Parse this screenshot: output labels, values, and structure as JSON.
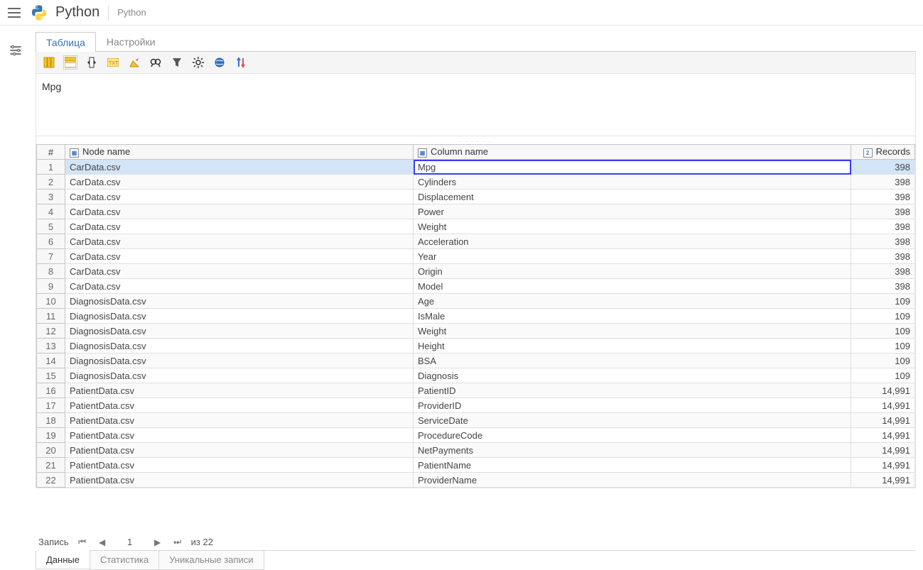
{
  "header": {
    "app_title": "Python",
    "breadcrumb": "Python"
  },
  "tabs": {
    "table": "Таблица",
    "settings": "Настройки"
  },
  "preview_value": "Mpg",
  "columns": {
    "index": "#",
    "node_name": "Node name",
    "column_name": "Column name",
    "records": "Records",
    "records_icon": "2"
  },
  "rows": [
    {
      "idx": 1,
      "node": "CarData.csv",
      "col": "Mpg",
      "rec": "398"
    },
    {
      "idx": 2,
      "node": "CarData.csv",
      "col": "Cylinders",
      "rec": "398"
    },
    {
      "idx": 3,
      "node": "CarData.csv",
      "col": "Displacement",
      "rec": "398"
    },
    {
      "idx": 4,
      "node": "CarData.csv",
      "col": "Power",
      "rec": "398"
    },
    {
      "idx": 5,
      "node": "CarData.csv",
      "col": "Weight",
      "rec": "398"
    },
    {
      "idx": 6,
      "node": "CarData.csv",
      "col": "Acceleration",
      "rec": "398"
    },
    {
      "idx": 7,
      "node": "CarData.csv",
      "col": "Year",
      "rec": "398"
    },
    {
      "idx": 8,
      "node": "CarData.csv",
      "col": "Origin",
      "rec": "398"
    },
    {
      "idx": 9,
      "node": "CarData.csv",
      "col": "Model",
      "rec": "398"
    },
    {
      "idx": 10,
      "node": "DiagnosisData.csv",
      "col": "Age",
      "rec": "109"
    },
    {
      "idx": 11,
      "node": "DiagnosisData.csv",
      "col": "IsMale",
      "rec": "109"
    },
    {
      "idx": 12,
      "node": "DiagnosisData.csv",
      "col": "Weight",
      "rec": "109"
    },
    {
      "idx": 13,
      "node": "DiagnosisData.csv",
      "col": "Height",
      "rec": "109"
    },
    {
      "idx": 14,
      "node": "DiagnosisData.csv",
      "col": "BSA",
      "rec": "109"
    },
    {
      "idx": 15,
      "node": "DiagnosisData.csv",
      "col": "Diagnosis",
      "rec": "109"
    },
    {
      "idx": 16,
      "node": "PatientData.csv",
      "col": "PatientID",
      "rec": "14,991"
    },
    {
      "idx": 17,
      "node": "PatientData.csv",
      "col": "ProviderID",
      "rec": "14,991"
    },
    {
      "idx": 18,
      "node": "PatientData.csv",
      "col": "ServiceDate",
      "rec": "14,991"
    },
    {
      "idx": 19,
      "node": "PatientData.csv",
      "col": "ProcedureCode",
      "rec": "14,991"
    },
    {
      "idx": 20,
      "node": "PatientData.csv",
      "col": "NetPayments",
      "rec": "14,991"
    },
    {
      "idx": 21,
      "node": "PatientData.csv",
      "col": "PatientName",
      "rec": "14,991"
    },
    {
      "idx": 22,
      "node": "PatientData.csv",
      "col": "ProviderName",
      "rec": "14,991"
    }
  ],
  "pager": {
    "label": "Запись",
    "current": "1",
    "of_text": "из 22"
  },
  "bottom_tabs": {
    "data": "Данные",
    "stats": "Статистика",
    "unique": "Уникальные записи"
  }
}
